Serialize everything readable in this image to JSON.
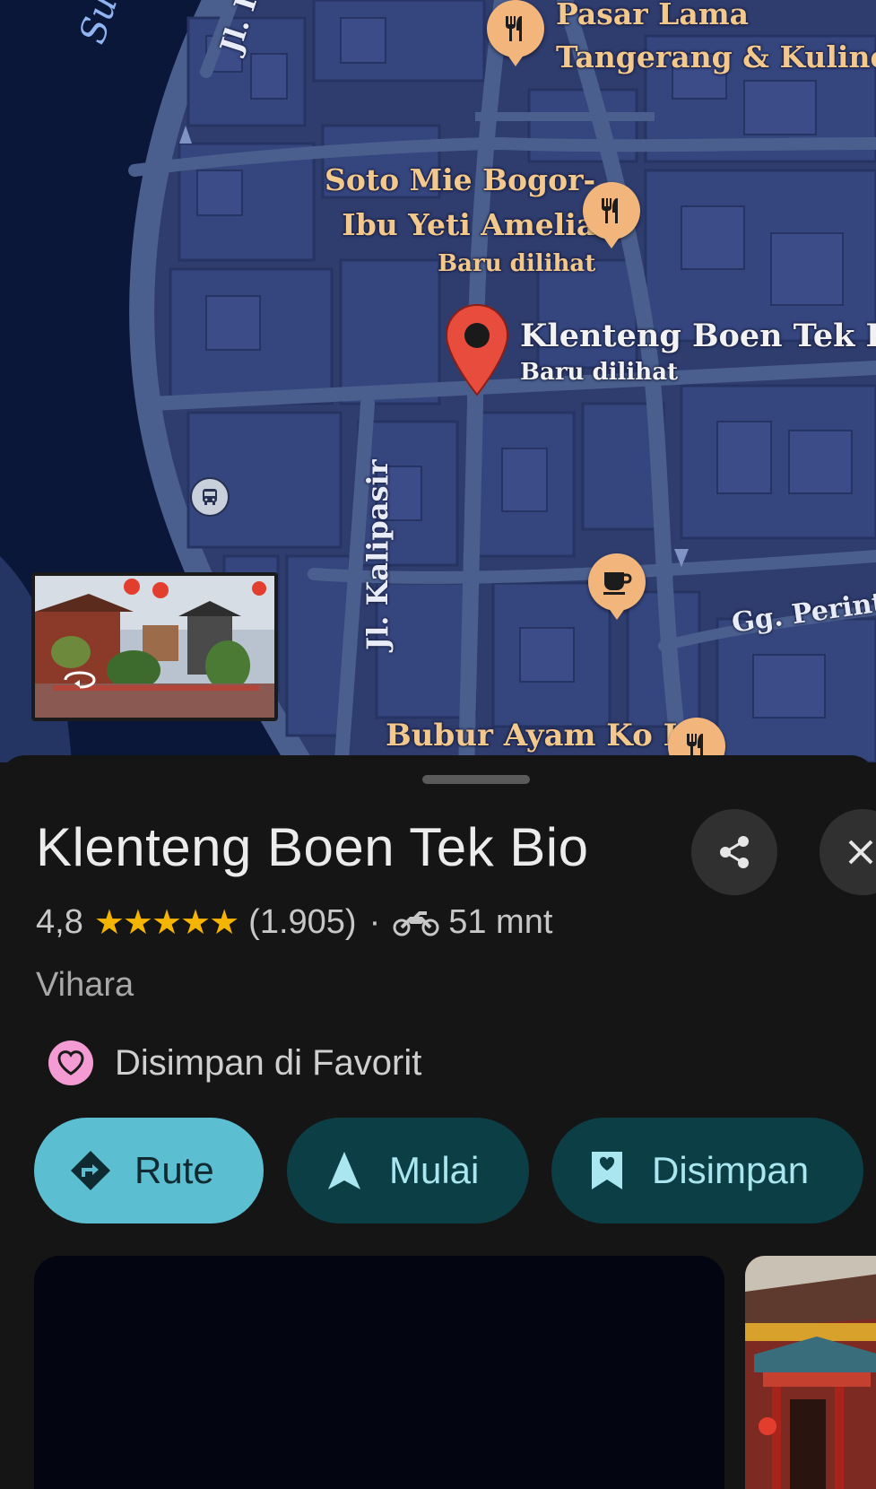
{
  "map": {
    "river_label": "Sungai C",
    "street_top": "Jl. I",
    "street_kalipasir": "Jl. Kalipasir",
    "street_perintis": "Gg. Perintis",
    "places": [
      {
        "line1": "Pasar Lama",
        "line2": "Tangerang & Kuliner",
        "icon": "restaurant-icon"
      },
      {
        "line1": "Soto Mie Bogor-",
        "line2": "Ibu Yeti Amelia",
        "sub": "Baru dilihat",
        "icon": "restaurant-icon"
      },
      {
        "line1": "Klenteng Boen Tek Bio",
        "sub": "Baru dilihat",
        "icon": "red-pin-icon"
      },
      {
        "line1": "Bubur Ayam Ko Iyo",
        "icon": "restaurant-icon"
      }
    ],
    "cafe_icon": "coffee-cup-icon",
    "bus_icon": "bus-icon"
  },
  "sheet": {
    "title": "Klenteng Boen Tek Bio",
    "rating": "4,8",
    "stars": "★★★★★",
    "review_count": "(1.905)",
    "separator": "·",
    "travel_time": "51 mnt",
    "category": "Vihara",
    "saved_in": "Disimpan di Favorit",
    "actions": {
      "route": "Rute",
      "start": "Mulai",
      "saved": "Disimpan"
    }
  },
  "colors": {
    "map_bg": "#2b3a6b",
    "river": "#0b1738",
    "poi": "#f2b57b",
    "pin": "#e74c3c",
    "route_btn": "#5bbfd1",
    "dark_btn": "#0c3f45",
    "accent_text": "#a9e6f0"
  }
}
